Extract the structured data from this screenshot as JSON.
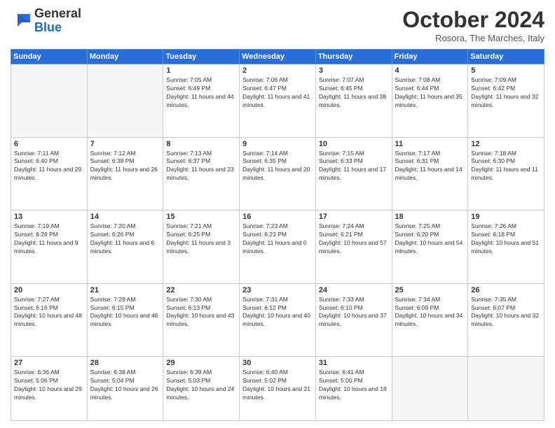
{
  "logo": {
    "line1": "General",
    "line2": "Blue"
  },
  "title": "October 2024",
  "subtitle": "Rosora, The Marches, Italy",
  "days_of_week": [
    "Sunday",
    "Monday",
    "Tuesday",
    "Wednesday",
    "Thursday",
    "Friday",
    "Saturday"
  ],
  "weeks": [
    [
      {
        "day": "",
        "empty": true
      },
      {
        "day": "",
        "empty": true
      },
      {
        "day": "1",
        "sunrise": "Sunrise: 7:05 AM",
        "sunset": "Sunset: 6:49 PM",
        "daylight": "Daylight: 11 hours and 44 minutes."
      },
      {
        "day": "2",
        "sunrise": "Sunrise: 7:06 AM",
        "sunset": "Sunset: 6:47 PM",
        "daylight": "Daylight: 11 hours and 41 minutes."
      },
      {
        "day": "3",
        "sunrise": "Sunrise: 7:07 AM",
        "sunset": "Sunset: 6:45 PM",
        "daylight": "Daylight: 11 hours and 38 minutes."
      },
      {
        "day": "4",
        "sunrise": "Sunrise: 7:08 AM",
        "sunset": "Sunset: 6:44 PM",
        "daylight": "Daylight: 11 hours and 35 minutes."
      },
      {
        "day": "5",
        "sunrise": "Sunrise: 7:09 AM",
        "sunset": "Sunset: 6:42 PM",
        "daylight": "Daylight: 11 hours and 32 minutes."
      }
    ],
    [
      {
        "day": "6",
        "sunrise": "Sunrise: 7:11 AM",
        "sunset": "Sunset: 6:40 PM",
        "daylight": "Daylight: 11 hours and 29 minutes."
      },
      {
        "day": "7",
        "sunrise": "Sunrise: 7:12 AM",
        "sunset": "Sunset: 6:38 PM",
        "daylight": "Daylight: 11 hours and 26 minutes."
      },
      {
        "day": "8",
        "sunrise": "Sunrise: 7:13 AM",
        "sunset": "Sunset: 6:37 PM",
        "daylight": "Daylight: 11 hours and 23 minutes."
      },
      {
        "day": "9",
        "sunrise": "Sunrise: 7:14 AM",
        "sunset": "Sunset: 6:35 PM",
        "daylight": "Daylight: 11 hours and 20 minutes."
      },
      {
        "day": "10",
        "sunrise": "Sunrise: 7:15 AM",
        "sunset": "Sunset: 6:33 PM",
        "daylight": "Daylight: 11 hours and 17 minutes."
      },
      {
        "day": "11",
        "sunrise": "Sunrise: 7:17 AM",
        "sunset": "Sunset: 6:31 PM",
        "daylight": "Daylight: 11 hours and 14 minutes."
      },
      {
        "day": "12",
        "sunrise": "Sunrise: 7:18 AM",
        "sunset": "Sunset: 6:30 PM",
        "daylight": "Daylight: 11 hours and 11 minutes."
      }
    ],
    [
      {
        "day": "13",
        "sunrise": "Sunrise: 7:19 AM",
        "sunset": "Sunset: 6:28 PM",
        "daylight": "Daylight: 11 hours and 9 minutes."
      },
      {
        "day": "14",
        "sunrise": "Sunrise: 7:20 AM",
        "sunset": "Sunset: 6:26 PM",
        "daylight": "Daylight: 11 hours and 6 minutes."
      },
      {
        "day": "15",
        "sunrise": "Sunrise: 7:21 AM",
        "sunset": "Sunset: 6:25 PM",
        "daylight": "Daylight: 11 hours and 3 minutes."
      },
      {
        "day": "16",
        "sunrise": "Sunrise: 7:23 AM",
        "sunset": "Sunset: 6:23 PM",
        "daylight": "Daylight: 11 hours and 0 minutes."
      },
      {
        "day": "17",
        "sunrise": "Sunrise: 7:24 AM",
        "sunset": "Sunset: 6:21 PM",
        "daylight": "Daylight: 10 hours and 57 minutes."
      },
      {
        "day": "18",
        "sunrise": "Sunrise: 7:25 AM",
        "sunset": "Sunset: 6:20 PM",
        "daylight": "Daylight: 10 hours and 54 minutes."
      },
      {
        "day": "19",
        "sunrise": "Sunrise: 7:26 AM",
        "sunset": "Sunset: 6:18 PM",
        "daylight": "Daylight: 10 hours and 51 minutes."
      }
    ],
    [
      {
        "day": "20",
        "sunrise": "Sunrise: 7:27 AM",
        "sunset": "Sunset: 6:16 PM",
        "daylight": "Daylight: 10 hours and 48 minutes."
      },
      {
        "day": "21",
        "sunrise": "Sunrise: 7:29 AM",
        "sunset": "Sunset: 6:15 PM",
        "daylight": "Daylight: 10 hours and 46 minutes."
      },
      {
        "day": "22",
        "sunrise": "Sunrise: 7:30 AM",
        "sunset": "Sunset: 6:13 PM",
        "daylight": "Daylight: 10 hours and 43 minutes."
      },
      {
        "day": "23",
        "sunrise": "Sunrise: 7:31 AM",
        "sunset": "Sunset: 6:12 PM",
        "daylight": "Daylight: 10 hours and 40 minutes."
      },
      {
        "day": "24",
        "sunrise": "Sunrise: 7:33 AM",
        "sunset": "Sunset: 6:10 PM",
        "daylight": "Daylight: 10 hours and 37 minutes."
      },
      {
        "day": "25",
        "sunrise": "Sunrise: 7:34 AM",
        "sunset": "Sunset: 6:09 PM",
        "daylight": "Daylight: 10 hours and 34 minutes."
      },
      {
        "day": "26",
        "sunrise": "Sunrise: 7:35 AM",
        "sunset": "Sunset: 6:07 PM",
        "daylight": "Daylight: 10 hours and 32 minutes."
      }
    ],
    [
      {
        "day": "27",
        "sunrise": "Sunrise: 6:36 AM",
        "sunset": "Sunset: 5:06 PM",
        "daylight": "Daylight: 10 hours and 29 minutes."
      },
      {
        "day": "28",
        "sunrise": "Sunrise: 6:38 AM",
        "sunset": "Sunset: 5:04 PM",
        "daylight": "Daylight: 10 hours and 26 minutes."
      },
      {
        "day": "29",
        "sunrise": "Sunrise: 6:39 AM",
        "sunset": "Sunset: 5:03 PM",
        "daylight": "Daylight: 10 hours and 24 minutes."
      },
      {
        "day": "30",
        "sunrise": "Sunrise: 6:40 AM",
        "sunset": "Sunset: 5:02 PM",
        "daylight": "Daylight: 10 hours and 21 minutes."
      },
      {
        "day": "31",
        "sunrise": "Sunrise: 6:41 AM",
        "sunset": "Sunset: 5:00 PM",
        "daylight": "Daylight: 10 hours and 18 minutes."
      },
      {
        "day": "",
        "empty": true
      },
      {
        "day": "",
        "empty": true
      }
    ]
  ]
}
